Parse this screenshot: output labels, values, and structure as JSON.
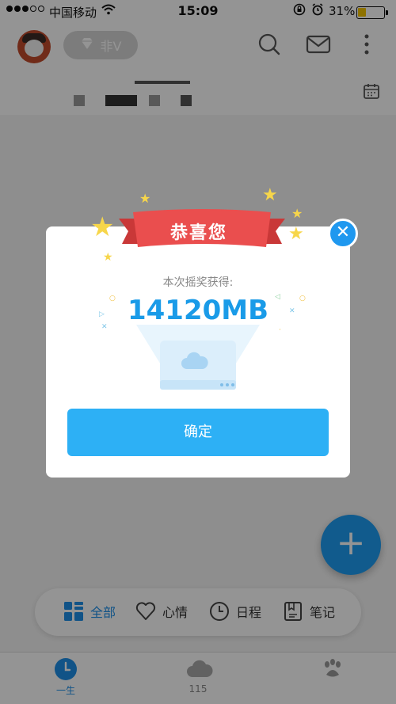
{
  "status": {
    "carrier": "中国移动",
    "time": "15:09",
    "battery_percent_text": "31%",
    "battery_level": 0.31
  },
  "header": {
    "vip_label": "非V",
    "icons": [
      "search-icon",
      "mail-icon",
      "more-icon",
      "calendar-icon"
    ]
  },
  "dialog": {
    "ribbon_title": "恭喜您",
    "subtitle": "本次摇奖获得:",
    "amount": "14120MB",
    "confirm_label": "确定"
  },
  "fab_label": "+",
  "filters": [
    {
      "label": "全部",
      "icon": "grid-icon",
      "active": true
    },
    {
      "label": "心情",
      "icon": "heart-icon",
      "active": false
    },
    {
      "label": "日程",
      "icon": "clock-icon",
      "active": false
    },
    {
      "label": "笔记",
      "icon": "note-icon",
      "active": false
    }
  ],
  "tabbar": [
    {
      "label": "一生",
      "icon": "timeline-clock-icon",
      "active": true
    },
    {
      "label": "115",
      "icon": "cloud-icon",
      "active": false
    }
  ],
  "colors": {
    "accent": "#1E9DF3",
    "ribbon": "#E94B4B",
    "star": "#F7D64A",
    "amount": "#1A9BE8"
  }
}
